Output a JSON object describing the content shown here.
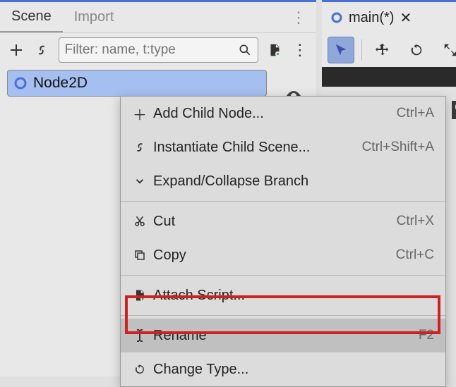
{
  "tabs": {
    "scene": "Scene",
    "import": "Import"
  },
  "toolbar": {
    "filter_placeholder": "Filter: name, t:type"
  },
  "tree": {
    "node_label": "Node2D"
  },
  "scene_tab": {
    "label": "main(*)"
  },
  "ruler": {
    "pct": "%"
  },
  "menu": {
    "add_child": "Add Child Node...",
    "add_child_sc": "Ctrl+A",
    "instantiate": "Instantiate Child Scene...",
    "instantiate_sc": "Ctrl+Shift+A",
    "expand": "Expand/Collapse Branch",
    "cut": "Cut",
    "cut_sc": "Ctrl+X",
    "copy": "Copy",
    "copy_sc": "Ctrl+C",
    "attach": "Attach Script...",
    "rename": "Rename",
    "rename_sc": "F2",
    "change_type": "Change Type..."
  }
}
